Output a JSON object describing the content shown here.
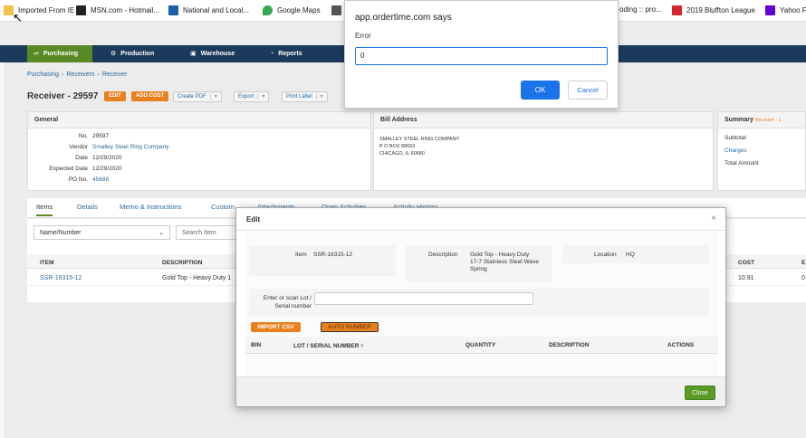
{
  "bookmarks": [
    {
      "label": "Imported From IE",
      "icon": "folder-icon",
      "color": "#f2c14e"
    },
    {
      "label": "MSN.com - Hotmail...",
      "icon": "msn-icon",
      "color": "#222222"
    },
    {
      "label": "National and Local...",
      "icon": "news-icon",
      "color": "#1f5faa"
    },
    {
      "label": "Google Maps",
      "icon": "map-pin-icon",
      "color": "#34a853"
    },
    {
      "label": "oding :: pro...",
      "icon": "bookmark-icon",
      "color": "#555555"
    },
    {
      "label": "2019 Bluffton League",
      "icon": "league-icon",
      "color": "#d7262b"
    },
    {
      "label": "Yahoo F",
      "icon": "yahoo-icon",
      "color": "#6001d2"
    }
  ],
  "nav": {
    "tabs": [
      "Purchasing",
      "Production",
      "Warehouse",
      "Reports"
    ]
  },
  "breadcrumb": [
    "Purchasing",
    "Receivers",
    "Receiver"
  ],
  "title": {
    "text": "Receiver - 29597",
    "edit": "EDIT",
    "add_cost": "ADD COST",
    "create_pdf": "Create PDF",
    "export": "Export",
    "print_label": "Print Label"
  },
  "general": {
    "header": "General",
    "fields": [
      {
        "label": "No.",
        "value": "29597"
      },
      {
        "label": "Vendor",
        "value": "Smalley Steel Ring Company"
      },
      {
        "label": "Date",
        "value": "12/29/2020"
      },
      {
        "label": "Expected Date",
        "value": "12/29/2020"
      },
      {
        "label": "PO No.",
        "value": "45688"
      }
    ]
  },
  "bill_address": {
    "header": "Bill Address",
    "lines": [
      "SMALLEY STEEL RING COMPANY",
      "P O BOX 88663",
      "CHICAGO, IL 60680"
    ]
  },
  "summary": {
    "header": "Summary",
    "revision": "Revision : 1",
    "rows": [
      "Subtotal",
      "Charges",
      "Total Amount"
    ]
  },
  "item_tabs": [
    "Items",
    "Details",
    "Memo & Instructions",
    "Custom",
    "Attachments",
    "Open Activities",
    "Activity History"
  ],
  "filter": {
    "select": "Name/Number",
    "search_placeholder": "Search Item"
  },
  "items_table": {
    "headers": [
      "ITEM",
      "DESCRIPTION",
      "COST",
      "E"
    ],
    "rows": [
      {
        "item": "SSR-16315-12",
        "description": "Gold Top - Heavy Duty 1",
        "cost": "10.91",
        "extra": "0"
      }
    ]
  },
  "alert": {
    "title": "app.ordertime.com says",
    "message": "Error",
    "input_value": "0",
    "ok": "OK",
    "cancel": "Cancel"
  },
  "modal": {
    "title": "Edit",
    "close_x": "×",
    "item_label": "Item",
    "item_value": "SSR-16315-12",
    "desc_label": "Description",
    "desc_value": [
      "Gold Top - Heavy Duty",
      "17-7 Stainless Steel Wave",
      "Spring"
    ],
    "location_label": "Location",
    "location_value": "HQ",
    "lot_label": [
      "Enter or scan Lot /",
      "Serial number"
    ],
    "import_csv": "IMPORT CSV",
    "auto_number": "AUTO NUMBER",
    "headers": [
      "BIN",
      "LOT / SERIAL NUMBER",
      "QUANTITY",
      "DESCRIPTION",
      "ACTIONS"
    ],
    "close_button": "Close"
  }
}
